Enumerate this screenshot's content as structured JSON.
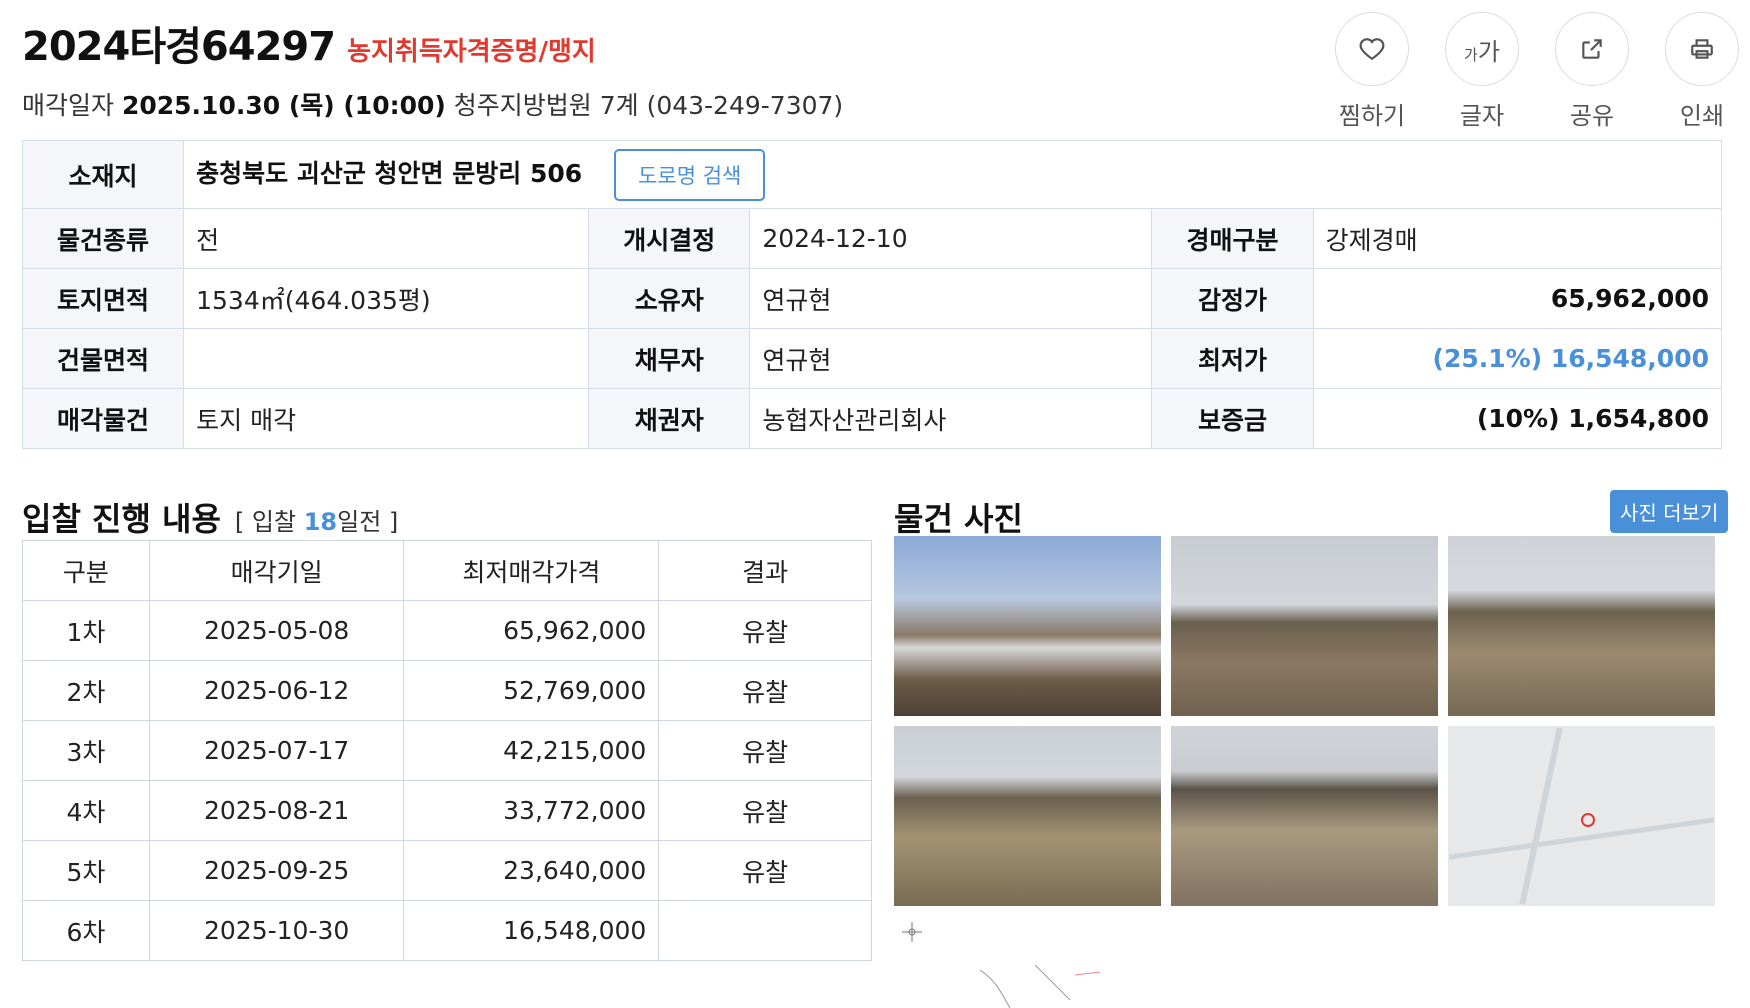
{
  "header": {
    "case_no": "2024타경64297",
    "case_tag": "농지취득자격증명/맹지",
    "sale_label": "매각일자",
    "sale_datetime": "2025.10.30 (목) (10:00)",
    "court": "청주지방법원 7계 (043-249-7307)"
  },
  "actions": [
    {
      "label": "찜하기",
      "icon": "heart-icon"
    },
    {
      "label": "글자",
      "icon": "font-size-icon"
    },
    {
      "label": "공유",
      "icon": "share-icon"
    },
    {
      "label": "인쇄",
      "icon": "print-icon"
    }
  ],
  "font_glyph": {
    "small": "가",
    "large": "가"
  },
  "info": {
    "address_label": "소재지",
    "address": "충청북도 괴산군 청안면 문방리 506",
    "road_search": "도로명 검색",
    "rows": [
      [
        {
          "k": "물건종류",
          "v": "전"
        },
        {
          "k": "개시결정",
          "v": "2024-12-10"
        },
        {
          "k": "경매구분",
          "v": "강제경매"
        }
      ],
      [
        {
          "k": "토지면적",
          "v": "1534㎡(464.035평)"
        },
        {
          "k": "소유자",
          "v": "연규현"
        },
        {
          "k": "감정가",
          "v": "65,962,000"
        }
      ],
      [
        {
          "k": "건물면적",
          "v": ""
        },
        {
          "k": "채무자",
          "v": "연규현"
        },
        {
          "k": "최저가",
          "v": "(25.1%) 16,548,000"
        }
      ],
      [
        {
          "k": "매각물건",
          "v": "토지 매각"
        },
        {
          "k": "채권자",
          "v": "농협자산관리회사"
        },
        {
          "k": "보증금",
          "v": "(10%) 1,654,800"
        }
      ]
    ]
  },
  "bid": {
    "title": "입찰 진행 내용",
    "note_prefix": "[ 입찰 ",
    "note_days": "18",
    "note_suffix": "일전 ]",
    "columns": [
      "구분",
      "매각기일",
      "최저매각가격",
      "결과"
    ],
    "rows": [
      [
        "1차",
        "2025-05-08",
        "65,962,000",
        "유찰"
      ],
      [
        "2차",
        "2025-06-12",
        "52,769,000",
        "유찰"
      ],
      [
        "3차",
        "2025-07-17",
        "42,215,000",
        "유찰"
      ],
      [
        "4차",
        "2025-08-21",
        "33,772,000",
        "유찰"
      ],
      [
        "5차",
        "2025-09-25",
        "23,640,000",
        "유찰"
      ],
      [
        "6차",
        "2025-10-30",
        "16,548,000",
        ""
      ]
    ]
  },
  "photos": {
    "title": "물건 사진",
    "more": "사진 더보기"
  },
  "colors": {
    "accent_blue": "#4a90d9",
    "tag_red": "#e03a2f"
  }
}
